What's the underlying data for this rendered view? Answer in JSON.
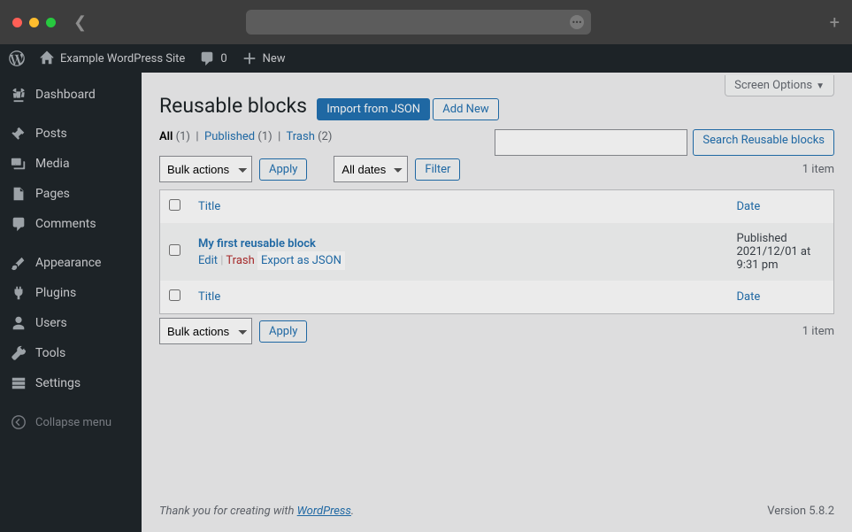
{
  "chrome": {
    "plus": "+"
  },
  "adminbar": {
    "site_title": "Example WordPress Site",
    "comments_count": "0",
    "new_label": "New"
  },
  "sidebar": {
    "items": [
      {
        "label": "Dashboard"
      },
      {
        "label": "Posts"
      },
      {
        "label": "Media"
      },
      {
        "label": "Pages"
      },
      {
        "label": "Comments"
      },
      {
        "label": "Appearance"
      },
      {
        "label": "Plugins"
      },
      {
        "label": "Users"
      },
      {
        "label": "Tools"
      },
      {
        "label": "Settings"
      }
    ],
    "collapse_label": "Collapse menu"
  },
  "screen_options_label": "Screen Options",
  "page_title": "Reusable blocks",
  "buttons": {
    "import_json": "Import from JSON",
    "add_new": "Add New",
    "apply": "Apply",
    "filter": "Filter",
    "search": "Search Reusable blocks"
  },
  "views": {
    "all_label": "All",
    "all_count": "(1)",
    "published_label": "Published",
    "published_count": "(1)",
    "trash_label": "Trash",
    "trash_count": "(2)"
  },
  "bulk_actions_label": "Bulk actions",
  "all_dates_label": "All dates",
  "items_count_label": "1 item",
  "columns": {
    "title": "Title",
    "date": "Date"
  },
  "row": {
    "title": "My first reusable block",
    "actions": {
      "edit": "Edit",
      "trash": "Trash",
      "export": "Export as JSON"
    },
    "date_status": "Published",
    "date_line2": "2021/12/01 at",
    "date_line3": "9:31 pm"
  },
  "footer": {
    "thanks_prefix": "Thank you for creating with ",
    "wp_link": "WordPress",
    "period": ".",
    "version": "Version 5.8.2"
  }
}
